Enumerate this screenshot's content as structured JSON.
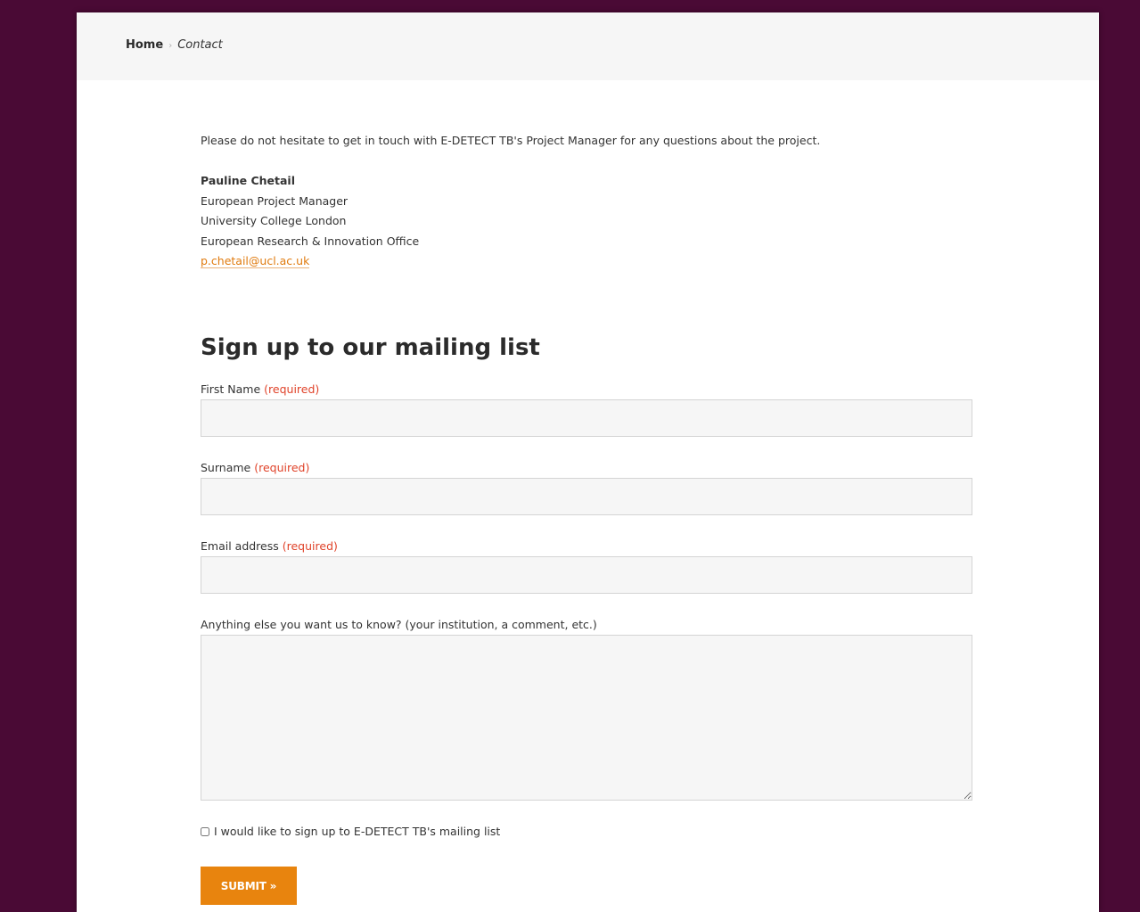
{
  "breadcrumb": {
    "home": "Home",
    "separator": "›",
    "current": "Contact"
  },
  "intro": "Please do not hesitate to get in touch with E-DETECT TB's Project Manager for any questions about the project.",
  "contact": {
    "name": "Pauline Chetail",
    "role": "European Project Manager",
    "institution": "University College London",
    "office": "European Research & Innovation Office",
    "email": "p.chetail@ucl.ac.uk"
  },
  "form": {
    "title": "Sign up to our mailing list",
    "required_marker": "(required)",
    "first_name_label": "First Name",
    "first_name_value": "",
    "surname_label": "Surname",
    "surname_value": "",
    "email_label": "Email address",
    "email_value": "",
    "comment_label": "Anything else you want us to know? (your institution, a comment, etc.)",
    "comment_value": "",
    "checkbox_label": "I would like to sign up to E-DETECT TB's mailing list",
    "checkbox_checked": false,
    "submit_label": "SUBMIT »"
  },
  "colors": {
    "background": "#4a0a35",
    "accent": "#e8840e",
    "required": "#e0432a"
  }
}
